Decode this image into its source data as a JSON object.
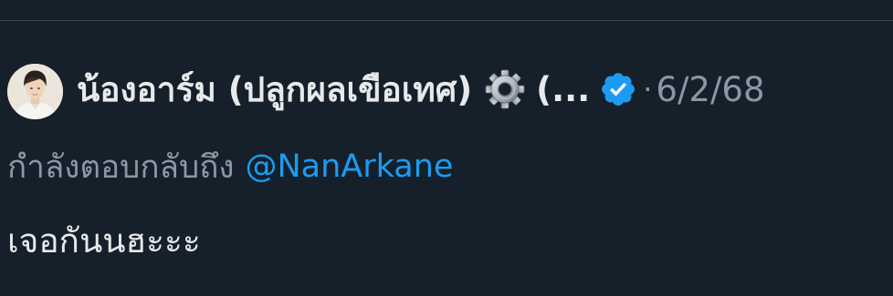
{
  "tweet": {
    "author_name": "น้องอาร์ม (ปลูกผลเขือเทศ)",
    "author_emoji_icon": "gear-icon",
    "name_overflow": "(...",
    "verified_icon": "verified-badge-icon",
    "separator": "·",
    "timestamp": "6/2/68",
    "reply_prefix": "กำลังตอบกลับถึง",
    "reply_handle": "@NanArkane",
    "text": "เจอกันนฮะะะ"
  },
  "colors": {
    "background": "#15202b",
    "primary_text": "#e7e9ea",
    "secondary_text": "#8b98a5",
    "accent": "#1d9bf0",
    "divider": "#38444d"
  }
}
